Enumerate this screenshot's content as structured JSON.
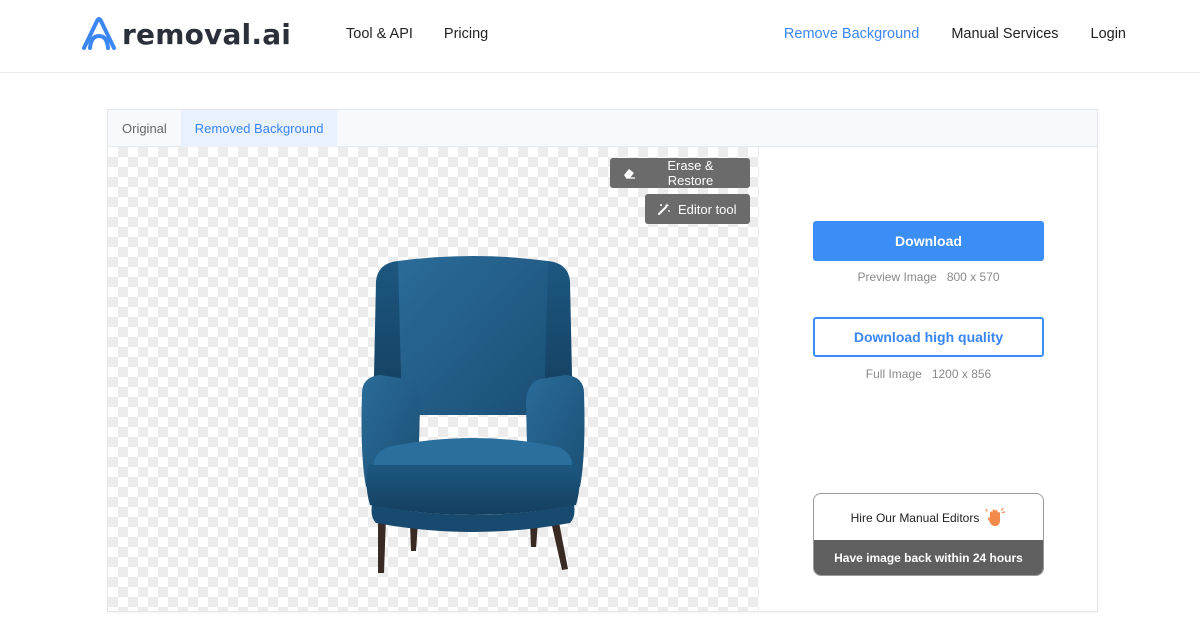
{
  "brand": {
    "name": "removal.ai",
    "accent_color": "#3a86f3",
    "logo_icon": "removal-logo-icon"
  },
  "nav": {
    "left": [
      {
        "label": "Tool & API"
      },
      {
        "label": "Pricing"
      }
    ],
    "right": [
      {
        "label": "Remove Background",
        "active": true
      },
      {
        "label": "Manual Services"
      },
      {
        "label": "Login"
      }
    ]
  },
  "tabs": [
    {
      "label": "Original",
      "active": false
    },
    {
      "label": "Removed Background",
      "active": true
    }
  ],
  "tools": {
    "erase_restore": {
      "label": "Erase & Restore",
      "icon": "eraser-icon"
    },
    "editor": {
      "label": "Editor tool",
      "icon": "magic-wand-icon"
    }
  },
  "download": {
    "button_label": "Download",
    "preview_label": "Preview Image",
    "preview_size": "800 x 570",
    "hq_button_label": "Download high quality",
    "full_label": "Full Image",
    "full_size": "1200 x 856",
    "button_color": "#3a8ef6"
  },
  "hire": {
    "title": "Hire Our Manual Editors",
    "icon": "waving-hand-icon",
    "subtitle": "Have image back within 24 hours"
  },
  "image": {
    "subject": "blue-armchair-image",
    "color": "#1f5c86"
  }
}
